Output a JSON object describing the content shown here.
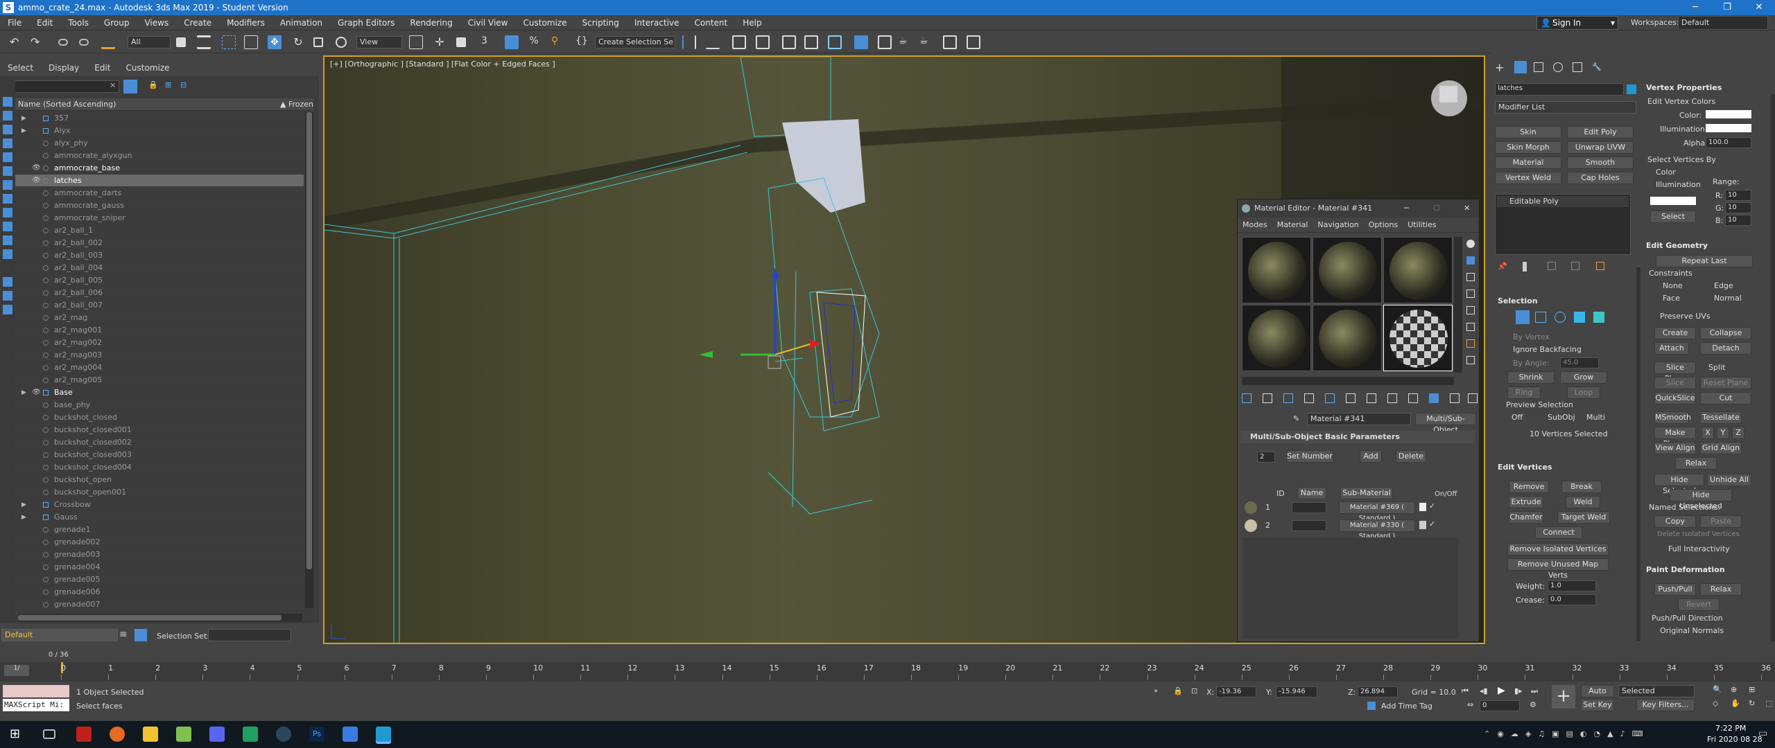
{
  "title_bar": {
    "text": "ammo_crate_24.max - Autodesk 3ds Max 2019 - Student Version",
    "min": "─",
    "max": "❐",
    "close": "✕"
  },
  "menu": [
    "File",
    "Edit",
    "Tools",
    "Group",
    "Views",
    "Create",
    "Modifiers",
    "Animation",
    "Graph Editors",
    "Rendering",
    "Civil View",
    "Customize",
    "Scripting",
    "Interactive",
    "Content",
    "Help"
  ],
  "account": {
    "sign_in": "Sign In",
    "workspaces_label": "Workspaces:",
    "workspace": "Default"
  },
  "toolbar": {
    "filter": "All",
    "ref_coord": "View",
    "named_sel": "Create Selection Se"
  },
  "scene_explorer": {
    "menu": [
      "Select",
      "Display",
      "Edit",
      "Customize"
    ],
    "col_name": "Name (Sorted Ascending)",
    "col_frozen": "▲ Frozen",
    "rows": [
      {
        "name": "357",
        "type": "group"
      },
      {
        "name": "Alyx",
        "type": "group"
      },
      {
        "name": "alyx_phy",
        "type": "obj"
      },
      {
        "name": "ammocrate_alyxgun",
        "type": "obj"
      },
      {
        "name": "ammocrate_base",
        "type": "vis"
      },
      {
        "name": "latches",
        "type": "sel"
      },
      {
        "name": "ammocrate_darts",
        "type": "obj"
      },
      {
        "name": "ammocrate_gauss",
        "type": "obj"
      },
      {
        "name": "ammocrate_sniper",
        "type": "obj"
      },
      {
        "name": "ar2_ball_1",
        "type": "obj"
      },
      {
        "name": "ar2_ball_002",
        "type": "obj"
      },
      {
        "name": "ar2_ball_003",
        "type": "obj"
      },
      {
        "name": "ar2_ball_004",
        "type": "obj"
      },
      {
        "name": "ar2_ball_005",
        "type": "obj"
      },
      {
        "name": "ar2_ball_006",
        "type": "obj"
      },
      {
        "name": "ar2_ball_007",
        "type": "obj"
      },
      {
        "name": "ar2_mag",
        "type": "obj"
      },
      {
        "name": "ar2_mag001",
        "type": "obj"
      },
      {
        "name": "ar2_mag002",
        "type": "obj"
      },
      {
        "name": "ar2_mag003",
        "type": "obj"
      },
      {
        "name": "ar2_mag004",
        "type": "obj"
      },
      {
        "name": "ar2_mag005",
        "type": "obj"
      },
      {
        "name": "Base",
        "type": "vgroup"
      },
      {
        "name": "base_phy",
        "type": "obj"
      },
      {
        "name": "buckshot_closed",
        "type": "obj"
      },
      {
        "name": "buckshot_closed001",
        "type": "obj"
      },
      {
        "name": "buckshot_closed002",
        "type": "obj"
      },
      {
        "name": "buckshot_closed003",
        "type": "obj"
      },
      {
        "name": "buckshot_closed004",
        "type": "obj"
      },
      {
        "name": "buckshot_open",
        "type": "obj"
      },
      {
        "name": "buckshot_open001",
        "type": "obj"
      },
      {
        "name": "Crossbow",
        "type": "group"
      },
      {
        "name": "Gauss",
        "type": "group"
      },
      {
        "name": "grenade1",
        "type": "obj"
      },
      {
        "name": "grenade002",
        "type": "obj"
      },
      {
        "name": "grenade003",
        "type": "obj"
      },
      {
        "name": "grenade004",
        "type": "obj"
      },
      {
        "name": "grenade005",
        "type": "obj"
      },
      {
        "name": "grenade006",
        "type": "obj"
      },
      {
        "name": "grenade007",
        "type": "obj"
      }
    ],
    "layer": "Default",
    "selection_set_label": "Selection Set:"
  },
  "viewport": {
    "label": "[+] [Orthographic ] [Standard ] [Flat Color + Edged Faces ]"
  },
  "material_editor": {
    "title": "Material Editor - Material #341",
    "menu": [
      "Modes",
      "Material",
      "Navigation",
      "Options",
      "Utilities"
    ],
    "material_name": "Material #341",
    "type": "Multi/Sub-Object",
    "rollout": "Multi/Sub-Object Basic Parameters",
    "count": "2",
    "set_number": "Set Number",
    "add": "Add",
    "delete": "Delete",
    "col_id": "ID",
    "col_name": "Name",
    "col_sub": "Sub-Material",
    "col_onoff": "On/Off",
    "rows": [
      {
        "id": "1",
        "sub": "Material #369  ( Standard )"
      },
      {
        "id": "2",
        "sub": "Material #330  ( Standard )"
      }
    ]
  },
  "command_panel": {
    "object_name": "latches",
    "modifier_list": "Modifier List",
    "buttons": [
      "Skin",
      "Edit Poly",
      "Skin Morph",
      "Unwrap UVW",
      "Material",
      "Smooth",
      "Vertex Weld",
      "Cap Holes"
    ],
    "stack_item": "Editable Poly",
    "selection": {
      "title": "Selection",
      "by_vertex": "By Vertex",
      "ignore_backfacing": "Ignore Backfacing",
      "by_angle": "By Angle:",
      "angle": "45.0",
      "shrink": "Shrink",
      "grow": "Grow",
      "ring": "Ring",
      "loop": "Loop",
      "preview_title": "Preview Selection",
      "off": "Off",
      "subobj": "SubObj",
      "multi": "Multi",
      "status": "10 Vertices Selected"
    },
    "edit_vertices": {
      "title": "Edit Vertices",
      "remove": "Remove",
      "break": "Break",
      "extrude": "Extrude",
      "weld": "Weld",
      "chamfer": "Chamfer",
      "target_weld": "Target Weld",
      "connect": "Connect",
      "remove_isolated": "Remove Isolated Vertices",
      "remove_unused": "Remove Unused Map Verts",
      "weight_label": "Weight:",
      "weight": "1.0",
      "crease_label": "Crease:",
      "crease": "0.0"
    },
    "vertex_props": {
      "title": "Vertex Properties",
      "edit_colors": "Edit Vertex Colors",
      "color": "Color:",
      "illum": "Illumination:",
      "alpha": "Alpha:",
      "alpha_val": "100.0",
      "select_by": "Select Vertices By",
      "opt_color": "Color",
      "opt_illum": "Illumination",
      "range": "Range:",
      "r": "R:",
      "g": "G:",
      "b": "B:",
      "rv": "10",
      "gv": "10",
      "bv": "10",
      "select": "Select"
    },
    "edit_geometry": {
      "title": "Edit Geometry",
      "repeat_last": "Repeat Last",
      "constraints": "Constraints",
      "none": "None",
      "edge": "Edge",
      "face": "Face",
      "normal": "Normal",
      "preserve_uvs": "Preserve UVs",
      "create": "Create",
      "collapse": "Collapse",
      "attach": "Attach",
      "detach": "Detach",
      "slice_plane": "Slice Plane",
      "split": "Split",
      "slice": "Slice",
      "reset_plane": "Reset Plane",
      "quickslice": "QuickSlice",
      "cut": "Cut",
      "msmooth": "MSmooth",
      "tessellate": "Tessellate",
      "make_planar": "Make Planar",
      "x": "X",
      "y": "Y",
      "z": "Z",
      "view_align": "View Align",
      "grid_align": "Grid Align",
      "relax": "Relax",
      "hide_selected": "Hide Selected",
      "unhide_all": "Unhide All",
      "hide_unselected": "Hide Unselected",
      "named_sel": "Named Selections:",
      "copy": "Copy",
      "paste": "Paste",
      "delete_isolated": "Delete Isolated Vertices",
      "full_interactivity": "Full Interactivity"
    },
    "paint_def": {
      "title": "Paint Deformation",
      "push_pull": "Push/Pull",
      "relax": "Relax",
      "revert": "Revert",
      "direction": "Push/Pull Direction",
      "original": "Original Normals"
    }
  },
  "timeline": {
    "frame": "0 / 36",
    "ticks": [
      "0",
      "1",
      "2",
      "3",
      "4",
      "5",
      "6",
      "7",
      "8",
      "9",
      "10",
      "11",
      "12",
      "13",
      "14",
      "15",
      "16",
      "17",
      "18",
      "19",
      "20",
      "21",
      "22",
      "23",
      "24",
      "25",
      "26",
      "27",
      "28",
      "29",
      "30",
      "31",
      "32",
      "33",
      "34",
      "35",
      "36"
    ]
  },
  "status": {
    "maxscript": "MAXScript Mi:",
    "objects": "1 Object Selected",
    "prompt": "Select faces",
    "x_label": "X:",
    "x": "-19.36",
    "y_label": "Y:",
    "y": "-15.946",
    "z_label": "Z:",
    "z": "26.894",
    "grid": "Grid = 10.0",
    "add_time_tag": "Add Time Tag",
    "frame_field": "0",
    "auto_key": "Auto Key",
    "set_key": "Set Key",
    "selected": "Selected",
    "key_filters": "Key Filters..."
  },
  "taskbar": {
    "time": "7:22 PM",
    "date": "Fri 2020 08 28"
  }
}
